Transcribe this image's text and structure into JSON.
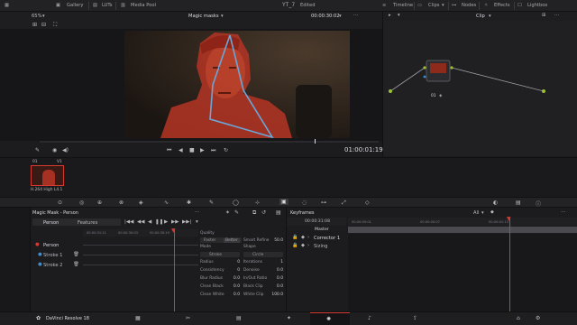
{
  "topbar": {
    "zoom": "65%",
    "gallery": "Gallery",
    "luts": "LUTs",
    "media_pool": "Media Pool",
    "project": "YT_7",
    "project_status": "Edited",
    "timeline": "Timeline",
    "clips": "Clips",
    "nodes": "Nodes",
    "effects": "Effects",
    "lightbox": "Lightbox"
  },
  "viewer": {
    "zoom": "65%",
    "title": "Magic masks",
    "timecode_top": "00:00:30:02",
    "timecode_big": "01:00:01:19"
  },
  "nodes": {
    "mode": "Clip",
    "node_label": "01"
  },
  "thumbnail": {
    "clip_num": "01",
    "track": "V1",
    "codec": "H.264 High L4.1"
  },
  "magic_mask": {
    "title": "Magic Mask - Person",
    "tab_person": "Person",
    "tab_features": "Features",
    "ruler": [
      "00:00:31:11",
      "00:00:30:03",
      "00:00:30:19"
    ],
    "tracks": [
      {
        "label": "Person",
        "color": "#d43a2f"
      },
      {
        "label": "Stroke 1",
        "color": "#3a8fd4"
      },
      {
        "label": "Stroke 2",
        "color": "#3a8fd4"
      }
    ],
    "quality_label": "Quality",
    "faster": "Faster",
    "better": "Better",
    "smart_refine_label": "Smart Refine",
    "smart_refine_value": "50.0",
    "mode_label": "Mode",
    "mode_value": "Stroke",
    "shape_label": "Shape",
    "shape_value": "Circle",
    "params": [
      {
        "l": "Radius",
        "v": "0",
        "l2": "Iterations",
        "v2": "1"
      },
      {
        "l": "Consistency",
        "v": "0",
        "l2": "Denoise",
        "v2": "0.0"
      },
      {
        "l": "Blur Radius",
        "v": "0.0",
        "l2": "In/Out Ratio",
        "v2": "0.0"
      },
      {
        "l": "Clean Black",
        "v": "0.0",
        "l2": "Black Clip",
        "v2": "0.0"
      },
      {
        "l": "Clean White",
        "v": "0.0",
        "l2": "White Clip",
        "v2": "100.0"
      }
    ]
  },
  "keyframes": {
    "title": "Keyframes",
    "filter": "All",
    "current_tc": "00:00:31:08",
    "ruler": [
      "00:00:00:01",
      "00:00:00:07",
      "00:00:01:13"
    ],
    "rows": [
      "Master",
      "Corrector 1",
      "Sizing"
    ]
  },
  "bottombar": {
    "app_name": "DaVinci Resolve 18"
  }
}
